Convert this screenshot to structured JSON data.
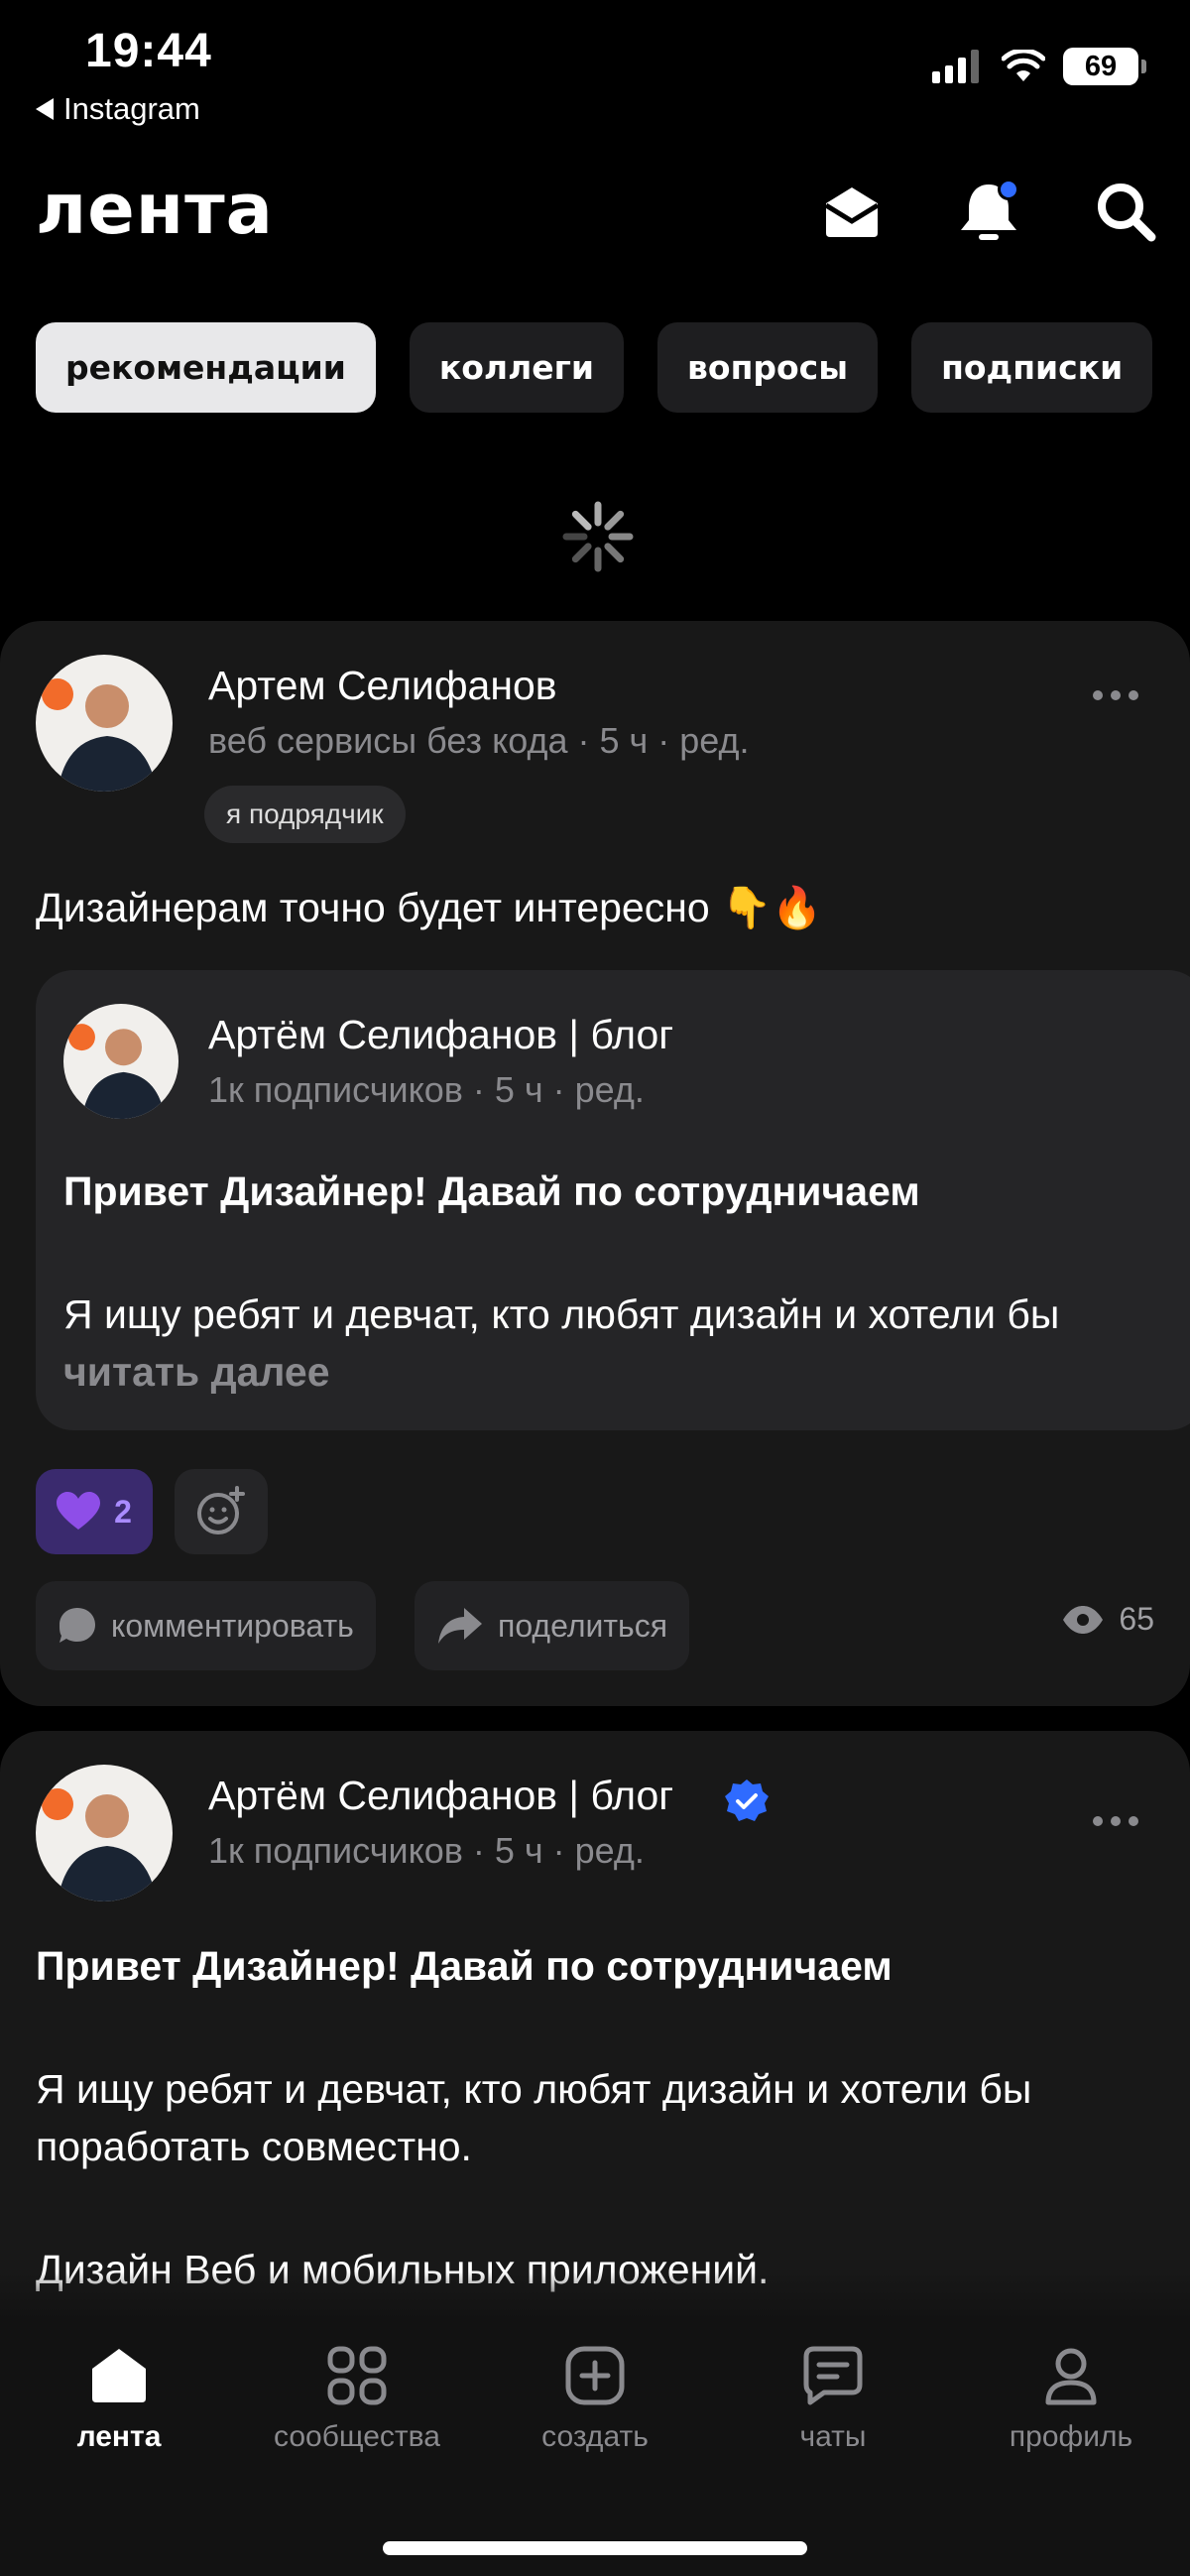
{
  "status_bar": {
    "time": "19:44",
    "back_app": "Instagram",
    "battery": "69"
  },
  "header": {
    "title": "лента"
  },
  "tabs": [
    {
      "label": "рекомендации",
      "active": true
    },
    {
      "label": "коллеги"
    },
    {
      "label": "вопросы"
    },
    {
      "label": "подписки"
    }
  ],
  "post1": {
    "author": "Артем Селифанов",
    "meta": "веб сервисы без кода · 5 ч · ред.",
    "badge": "я подрядчик",
    "text": "Дизайнерам точно будет интересно 👇🔥",
    "repost": {
      "author": "Артём Селифанов | блог",
      "meta": "1к подписчиков · 5 ч · ред.",
      "headline": "Привет Дизайнер! Давай по сотрудничаем",
      "body": "Я ищу ребят и девчат, кто любят дизайн и хотели бы",
      "read_more": "читать далее"
    },
    "reaction_count": "2",
    "comment_label": "комментировать",
    "share_label": "поделиться",
    "views": "65"
  },
  "post2": {
    "author": "Артём Селифанов | блог",
    "meta": "1к подписчиков · 5 ч · ред.",
    "headline": "Привет Дизайнер! Давай по сотрудничаем",
    "body1": "Я ищу ребят и девчат, кто любят дизайн и хотели бы",
    "body2": "поработать совместно.",
    "body3": "Дизайн Веб и мобильных приложений."
  },
  "bottom_nav": [
    {
      "label": "лента",
      "icon": "home-icon",
      "active": true
    },
    {
      "label": "сообщества",
      "icon": "grid-icon"
    },
    {
      "label": "создать",
      "icon": "plus-square-icon"
    },
    {
      "label": "чаты",
      "icon": "chat-icon"
    },
    {
      "label": "профиль",
      "icon": "profile-icon"
    }
  ],
  "colors": {
    "background": "#000000",
    "card": "#181818",
    "accent": "#2f6bff",
    "reaction": "#a98bff"
  }
}
